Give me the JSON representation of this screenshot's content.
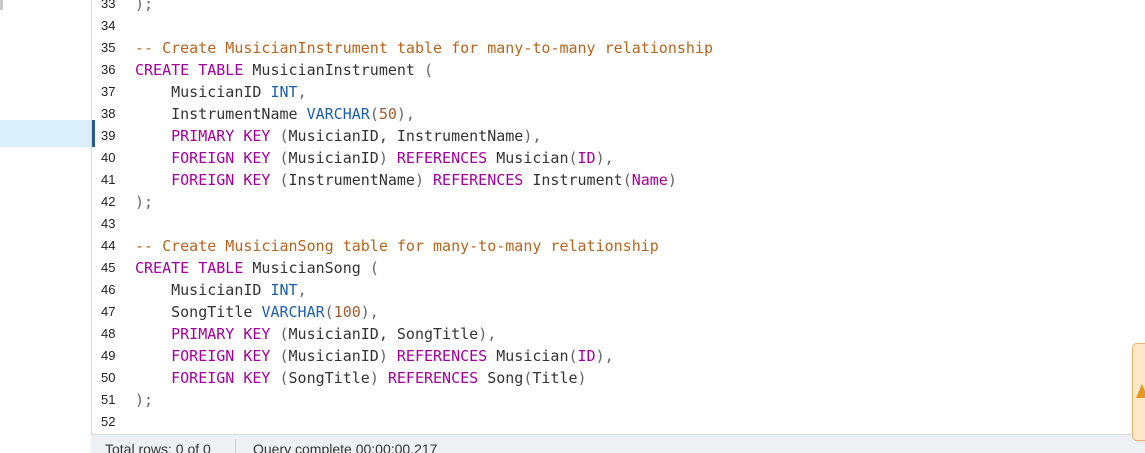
{
  "editor": {
    "lines": [
      {
        "num": "33",
        "segments": [
          {
            "t": ");",
            "c": "pu"
          }
        ]
      },
      {
        "num": "34",
        "segments": []
      },
      {
        "num": "35",
        "segments": [
          {
            "t": "-- Create MusicianInstrument table for many-to-many relationship",
            "c": "cm"
          }
        ]
      },
      {
        "num": "36",
        "segments": [
          {
            "t": "CREATE TABLE",
            "c": "kw"
          },
          {
            "t": " MusicianInstrument ",
            "c": ""
          },
          {
            "t": "(",
            "c": "pu"
          }
        ]
      },
      {
        "num": "37",
        "segments": [
          {
            "t": "    MusicianID ",
            "c": ""
          },
          {
            "t": "INT",
            "c": "ty"
          },
          {
            "t": ",",
            "c": "pu"
          }
        ]
      },
      {
        "num": "38",
        "segments": [
          {
            "t": "    InstrumentName ",
            "c": ""
          },
          {
            "t": "VARCHAR",
            "c": "ty"
          },
          {
            "t": "(",
            "c": "pu"
          },
          {
            "t": "50",
            "c": "nm"
          },
          {
            "t": "),",
            "c": "pu"
          }
        ]
      },
      {
        "num": "39",
        "segments": [
          {
            "t": "    ",
            "c": ""
          },
          {
            "t": "PRIMARY KEY",
            "c": "kw"
          },
          {
            "t": " ",
            "c": ""
          },
          {
            "t": "(",
            "c": "pu"
          },
          {
            "t": "MusicianID, InstrumentName",
            "c": ""
          },
          {
            "t": "),",
            "c": "pu"
          }
        ]
      },
      {
        "num": "40",
        "segments": [
          {
            "t": "    ",
            "c": ""
          },
          {
            "t": "FOREIGN KEY",
            "c": "kw"
          },
          {
            "t": " ",
            "c": ""
          },
          {
            "t": "(",
            "c": "pu"
          },
          {
            "t": "MusicianID",
            "c": ""
          },
          {
            "t": ")",
            "c": "pu"
          },
          {
            "t": " ",
            "c": ""
          },
          {
            "t": "REFERENCES",
            "c": "kw"
          },
          {
            "t": " Musician",
            "c": ""
          },
          {
            "t": "(",
            "c": "pu"
          },
          {
            "t": "ID",
            "c": "kw"
          },
          {
            "t": "),",
            "c": "pu"
          }
        ]
      },
      {
        "num": "41",
        "segments": [
          {
            "t": "    ",
            "c": ""
          },
          {
            "t": "FOREIGN KEY",
            "c": "kw"
          },
          {
            "t": " ",
            "c": ""
          },
          {
            "t": "(",
            "c": "pu"
          },
          {
            "t": "InstrumentName",
            "c": ""
          },
          {
            "t": ")",
            "c": "pu"
          },
          {
            "t": " ",
            "c": ""
          },
          {
            "t": "REFERENCES",
            "c": "kw"
          },
          {
            "t": " Instrument",
            "c": ""
          },
          {
            "t": "(",
            "c": "pu"
          },
          {
            "t": "Name",
            "c": "kw"
          },
          {
            "t": ")",
            "c": "pu"
          }
        ]
      },
      {
        "num": "42",
        "segments": [
          {
            "t": ");",
            "c": "pu"
          }
        ]
      },
      {
        "num": "43",
        "segments": []
      },
      {
        "num": "44",
        "segments": [
          {
            "t": "-- Create MusicianSong table for many-to-many relationship",
            "c": "cm"
          }
        ]
      },
      {
        "num": "45",
        "segments": [
          {
            "t": "CREATE TABLE",
            "c": "kw"
          },
          {
            "t": " MusicianSong ",
            "c": ""
          },
          {
            "t": "(",
            "c": "pu"
          }
        ]
      },
      {
        "num": "46",
        "segments": [
          {
            "t": "    MusicianID ",
            "c": ""
          },
          {
            "t": "INT",
            "c": "ty"
          },
          {
            "t": ",",
            "c": "pu"
          }
        ]
      },
      {
        "num": "47",
        "segments": [
          {
            "t": "    SongTitle ",
            "c": ""
          },
          {
            "t": "VARCHAR",
            "c": "ty"
          },
          {
            "t": "(",
            "c": "pu"
          },
          {
            "t": "100",
            "c": "nm"
          },
          {
            "t": "),",
            "c": "pu"
          }
        ]
      },
      {
        "num": "48",
        "segments": [
          {
            "t": "    ",
            "c": ""
          },
          {
            "t": "PRIMARY KEY",
            "c": "kw"
          },
          {
            "t": " ",
            "c": ""
          },
          {
            "t": "(",
            "c": "pu"
          },
          {
            "t": "MusicianID, SongTitle",
            "c": ""
          },
          {
            "t": "),",
            "c": "pu"
          }
        ]
      },
      {
        "num": "49",
        "segments": [
          {
            "t": "    ",
            "c": ""
          },
          {
            "t": "FOREIGN KEY",
            "c": "kw"
          },
          {
            "t": " ",
            "c": ""
          },
          {
            "t": "(",
            "c": "pu"
          },
          {
            "t": "MusicianID",
            "c": ""
          },
          {
            "t": ")",
            "c": "pu"
          },
          {
            "t": " ",
            "c": ""
          },
          {
            "t": "REFERENCES",
            "c": "kw"
          },
          {
            "t": " Musician",
            "c": ""
          },
          {
            "t": "(",
            "c": "pu"
          },
          {
            "t": "ID",
            "c": "kw"
          },
          {
            "t": "),",
            "c": "pu"
          }
        ]
      },
      {
        "num": "50",
        "segments": [
          {
            "t": "    ",
            "c": ""
          },
          {
            "t": "FOREIGN KEY",
            "c": "kw"
          },
          {
            "t": " ",
            "c": ""
          },
          {
            "t": "(",
            "c": "pu"
          },
          {
            "t": "SongTitle",
            "c": ""
          },
          {
            "t": ")",
            "c": "pu"
          },
          {
            "t": " ",
            "c": ""
          },
          {
            "t": "REFERENCES",
            "c": "kw"
          },
          {
            "t": " Song",
            "c": ""
          },
          {
            "t": "(",
            "c": "pu"
          },
          {
            "t": "Title",
            "c": ""
          },
          {
            "t": ")",
            "c": "pu"
          }
        ]
      },
      {
        "num": "51",
        "segments": [
          {
            "t": ");",
            "c": "pu"
          }
        ]
      },
      {
        "num": "52",
        "segments": []
      }
    ],
    "active_line": "39"
  },
  "status": {
    "rows": "Total rows: 0 of 0",
    "query": "Query complete 00:00:00.217"
  },
  "colors": {
    "comment": "#b5651d",
    "keyword": "#a3009b",
    "type": "#1b60a8",
    "number": "#a05a2c",
    "selection": "#dbeefb",
    "toast_bg": "#fde9c8",
    "toast_icon": "#e59a1c"
  },
  "icons": {
    "toast": "warning-triangle-icon"
  }
}
